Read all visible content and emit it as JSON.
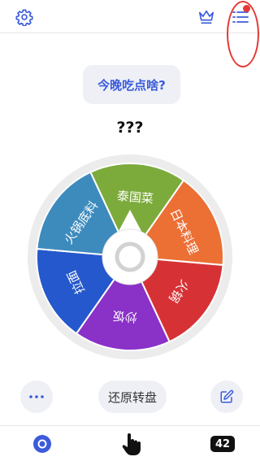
{
  "header": {
    "settings_icon": "gear-icon",
    "crown_icon": "crown-icon",
    "menu_icon": "list-menu-icon"
  },
  "question": "今晚吃点啥?",
  "result": "???",
  "wheel": {
    "segments": [
      {
        "label": "泰国菜",
        "color": "#7cab3c"
      },
      {
        "label": "日本料理",
        "color": "#ec6f34"
      },
      {
        "label": "火锅",
        "color": "#d63236"
      },
      {
        "label": "炒饭",
        "color": "#8a31c8"
      },
      {
        "label": "拉面",
        "color": "#2458cc"
      },
      {
        "label": "火锅底料",
        "color": "#3d8bbd"
      }
    ]
  },
  "controls": {
    "more_icon": "more-dots-icon",
    "reset_label": "还原转盘",
    "edit_icon": "edit-icon"
  },
  "navbar": {
    "wheel_icon": "wheel-tab-icon",
    "hand_icon": "tap-hand-icon",
    "count": "42"
  },
  "colors": {
    "accent": "#3b5bdb",
    "card_bg": "#eef0f6",
    "notify_dot": "#e53935"
  }
}
